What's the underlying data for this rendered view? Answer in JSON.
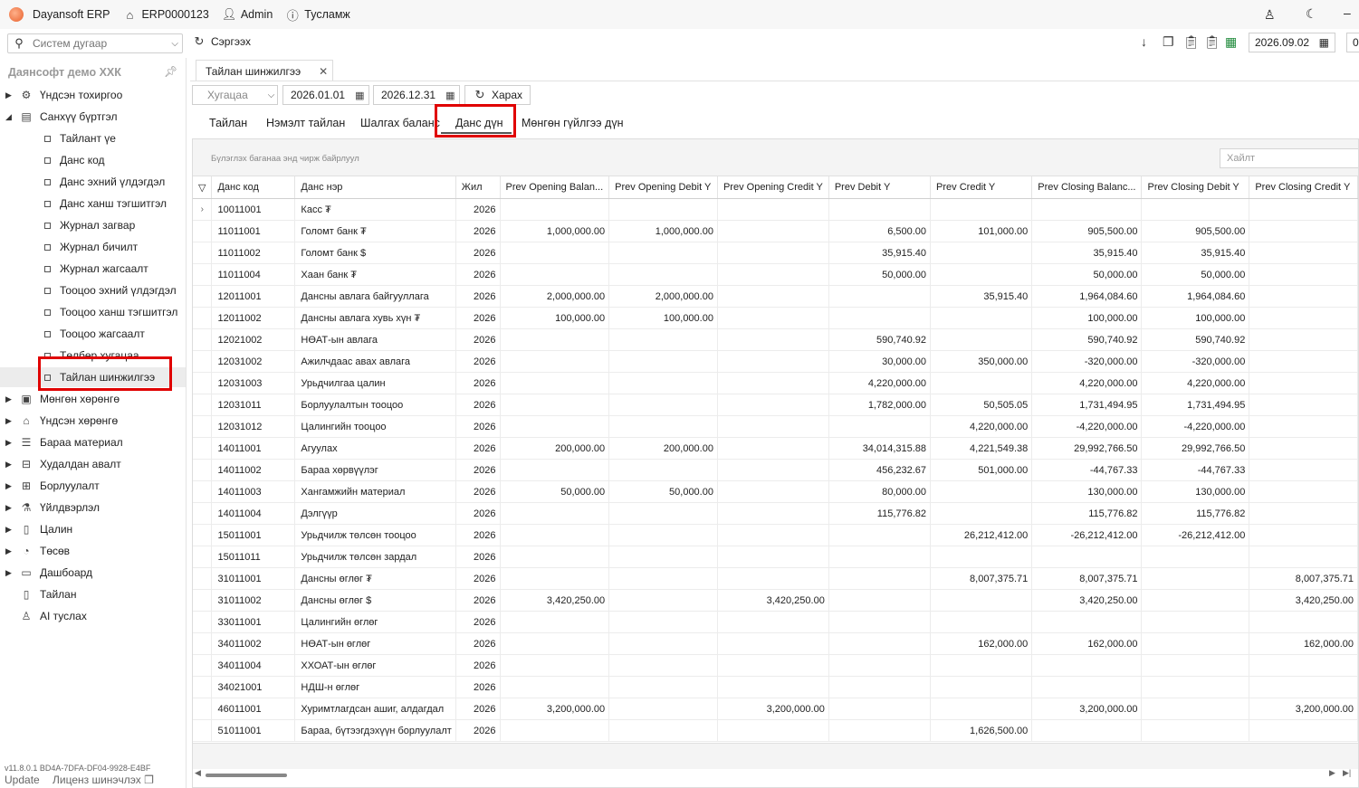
{
  "titlebar": {
    "app_name": "Dayansoft ERP",
    "system_code": "ERP0000123",
    "user": "Admin",
    "help": "Тусламж"
  },
  "toolbar": {
    "system_search_placeholder": "Систем дугаар",
    "refresh_label": "Сэргээх",
    "current_date": "2026.09.02",
    "right_cut": "0"
  },
  "sidebar": {
    "company": "Даянсофт демо ХХК",
    "top_items": [
      {
        "label": "Үндсэн тохиргоо",
        "icon": "gear-icon"
      },
      {
        "label": "Санхүү бүртгэл",
        "icon": "document-icon"
      }
    ],
    "children": [
      "Тайлант үе",
      "Данс код",
      "Данс эхний үлдэгдэл",
      "Данс ханш тэгшитгэл",
      "Журнал загвар",
      "Журнал бичилт",
      "Журнал жагсаалт",
      "Тооцоо эхний үлдэгдэл",
      "Тооцоо ханш тэгшитгэл",
      "Тооцоо жагсаалт",
      "Төлбөр хугацаа",
      "Тайлан шинжилгээ"
    ],
    "bottom_items": [
      {
        "label": "Мөнгөн хөрөнгө",
        "icon": "cash-icon"
      },
      {
        "label": "Үндсэн хөрөнгө",
        "icon": "asset-icon"
      },
      {
        "label": "Бараа материал",
        "icon": "inventory-icon"
      },
      {
        "label": "Худалдан авалт",
        "icon": "cart-icon"
      },
      {
        "label": "Борлуулалт",
        "icon": "sales-icon"
      },
      {
        "label": "Үйлдвэрлэл",
        "icon": "factory-icon"
      },
      {
        "label": "Цалин",
        "icon": "salary-icon"
      },
      {
        "label": "Төсөв",
        "icon": "pie-icon"
      },
      {
        "label": "Дашбоард",
        "icon": "dashboard-icon"
      },
      {
        "label": "Тайлан",
        "icon": "report-icon"
      },
      {
        "label": "AI туслах",
        "icon": "ai-icon"
      }
    ],
    "version": "v11.8.0.1   BD4A-7DFA-DF04-9928-E4BF",
    "update": "Update",
    "license": "Лиценз шинэчлэх"
  },
  "doctab": {
    "label": "Тайлан шинжилгээ",
    "close": "✕"
  },
  "filters": {
    "period_placeholder": "Хугацаа",
    "date_from": "2026.01.01",
    "date_to": "2026.12.31",
    "view_label": "Харах"
  },
  "subtabs": [
    "Тайлан",
    "Нэмэлт тайлан",
    "Шалгах баланс",
    "Данс дүн",
    "Мөнгөн гүйлгээ дүн"
  ],
  "grid": {
    "group_hint": "Бүлэглэх баганаа энд чирж байрлуул",
    "search_placeholder": "Хайлт",
    "columns": [
      "Данс код",
      "Данс нэр",
      "Жил",
      "Prev Opening Balan...",
      "Prev Opening Debit Y",
      "Prev Opening Credit Y",
      "Prev Debit Y",
      "Prev Credit Y",
      "Prev Closing Balanc...",
      "Prev Closing Debit Y",
      "Prev Closing Credit Y"
    ],
    "rows": [
      [
        "10011001",
        "Касс ₮",
        "2026",
        "",
        "",
        "",
        "",
        "",
        "",
        "",
        ""
      ],
      [
        "11011001",
        "Голомт банк ₮",
        "2026",
        "1,000,000.00",
        "1,000,000.00",
        "",
        "6,500.00",
        "101,000.00",
        "905,500.00",
        "905,500.00",
        ""
      ],
      [
        "11011002",
        "Голомт банк $",
        "2026",
        "",
        "",
        "",
        "35,915.40",
        "",
        "35,915.40",
        "35,915.40",
        ""
      ],
      [
        "11011004",
        "Хаан банк ₮",
        "2026",
        "",
        "",
        "",
        "50,000.00",
        "",
        "50,000.00",
        "50,000.00",
        ""
      ],
      [
        "12011001",
        "Дансны авлага байгууллага",
        "2026",
        "2,000,000.00",
        "2,000,000.00",
        "",
        "",
        "35,915.40",
        "1,964,084.60",
        "1,964,084.60",
        ""
      ],
      [
        "12011002",
        "Дансны авлага хувь хүн ₮",
        "2026",
        "100,000.00",
        "100,000.00",
        "",
        "",
        "",
        "100,000.00",
        "100,000.00",
        ""
      ],
      [
        "12021002",
        "НӨАТ-ын авлага",
        "2026",
        "",
        "",
        "",
        "590,740.92",
        "",
        "590,740.92",
        "590,740.92",
        ""
      ],
      [
        "12031002",
        "Ажилчдаас авах авлага",
        "2026",
        "",
        "",
        "",
        "30,000.00",
        "350,000.00",
        "-320,000.00",
        "-320,000.00",
        ""
      ],
      [
        "12031003",
        "Урьдчилгаа цалин",
        "2026",
        "",
        "",
        "",
        "4,220,000.00",
        "",
        "4,220,000.00",
        "4,220,000.00",
        ""
      ],
      [
        "12031011",
        "Борлуулалтын тооцоо",
        "2026",
        "",
        "",
        "",
        "1,782,000.00",
        "50,505.05",
        "1,731,494.95",
        "1,731,494.95",
        ""
      ],
      [
        "12031012",
        "Цалингийн тооцоо",
        "2026",
        "",
        "",
        "",
        "",
        "4,220,000.00",
        "-4,220,000.00",
        "-4,220,000.00",
        ""
      ],
      [
        "14011001",
        "Агуулах",
        "2026",
        "200,000.00",
        "200,000.00",
        "",
        "34,014,315.88",
        "4,221,549.38",
        "29,992,766.50",
        "29,992,766.50",
        ""
      ],
      [
        "14011002",
        "Бараа хөрвүүлэг",
        "2026",
        "",
        "",
        "",
        "456,232.67",
        "501,000.00",
        "-44,767.33",
        "-44,767.33",
        ""
      ],
      [
        "14011003",
        "Хангамжийн материал",
        "2026",
        "50,000.00",
        "50,000.00",
        "",
        "80,000.00",
        "",
        "130,000.00",
        "130,000.00",
        ""
      ],
      [
        "14011004",
        "Дэлгүүр",
        "2026",
        "",
        "",
        "",
        "115,776.82",
        "",
        "115,776.82",
        "115,776.82",
        ""
      ],
      [
        "15011001",
        "Урьдчилж төлсөн тооцоо",
        "2026",
        "",
        "",
        "",
        "",
        "26,212,412.00",
        "-26,212,412.00",
        "-26,212,412.00",
        ""
      ],
      [
        "15011011",
        "Урьдчилж төлсөн зардал",
        "2026",
        "",
        "",
        "",
        "",
        "",
        "",
        "",
        ""
      ],
      [
        "31011001",
        "Дансны өглөг ₮",
        "2026",
        "",
        "",
        "",
        "",
        "8,007,375.71",
        "8,007,375.71",
        "",
        "8,007,375.71"
      ],
      [
        "31011002",
        "Дансны өглөг $",
        "2026",
        "3,420,250.00",
        "",
        "3,420,250.00",
        "",
        "",
        "3,420,250.00",
        "",
        "3,420,250.00"
      ],
      [
        "33011001",
        "Цалингийн өглөг",
        "2026",
        "",
        "",
        "",
        "",
        "",
        "",
        "",
        ""
      ],
      [
        "34011002",
        "НӨАТ-ын өглөг",
        "2026",
        "",
        "",
        "",
        "",
        "162,000.00",
        "162,000.00",
        "",
        "162,000.00"
      ],
      [
        "34011004",
        "ХХОАТ-ын өглөг",
        "2026",
        "",
        "",
        "",
        "",
        "",
        "",
        "",
        ""
      ],
      [
        "34021001",
        "НДШ-н өглөг",
        "2026",
        "",
        "",
        "",
        "",
        "",
        "",
        "",
        ""
      ],
      [
        "46011001",
        "Хуримтлагдсан ашиг, алдагдал",
        "2026",
        "3,200,000.00",
        "",
        "3,200,000.00",
        "",
        "",
        "3,200,000.00",
        "",
        "3,200,000.00"
      ],
      [
        "51011001",
        "Бараа, бүтээгдэхүүн борлуулалт",
        "2026",
        "",
        "",
        "",
        "",
        "1,626,500.00",
        "",
        "",
        ""
      ]
    ]
  },
  "colors": {
    "highlight": "#e00000",
    "selected_bg": "#ececec"
  }
}
